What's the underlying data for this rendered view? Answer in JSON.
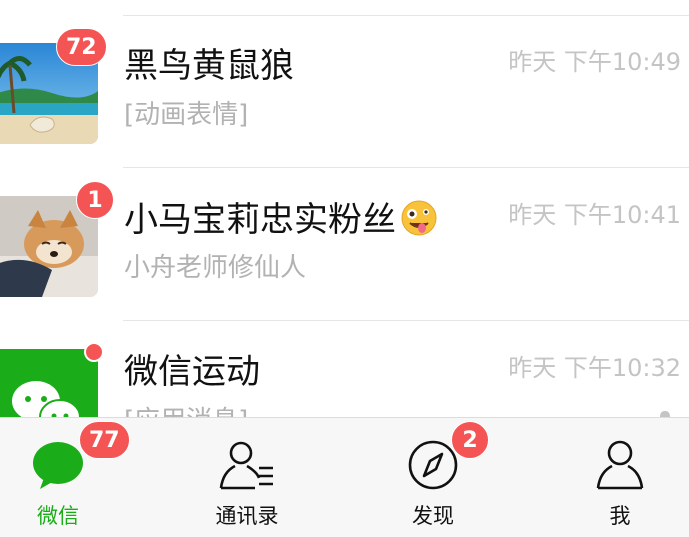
{
  "colors": {
    "accent": "#1aad19",
    "badge": "#f45454",
    "muted_text": "#b2b2b2",
    "tabbar_bg": "#f7f7f7"
  },
  "chats": [
    {
      "name": "黑鸟黄鼠狼",
      "preview": "[动画表情]",
      "time": "昨天 下午10:49",
      "badge": "72",
      "avatar": "beach-photo-avatar"
    },
    {
      "name": "小马宝莉忠实粉丝",
      "name_emoji": "zany-face-emoji",
      "preview": "小舟老师修仙人",
      "time": "昨天 下午10:41",
      "badge": "1",
      "avatar": "shiba-dog-photo-avatar"
    },
    {
      "name": "微信运动",
      "preview": "[应用消息]",
      "time": "昨天 下午10:32",
      "badge": null,
      "unread_dot": true,
      "avatar": "wechat-sports-avatar"
    }
  ],
  "tabbar": {
    "tabs": [
      {
        "label": "微信",
        "icon": "chat-bubble-icon",
        "badge": "77",
        "active": true
      },
      {
        "label": "通讯录",
        "icon": "contacts-icon",
        "badge": null,
        "active": false
      },
      {
        "label": "发现",
        "icon": "compass-icon",
        "badge": "2",
        "active": false
      },
      {
        "label": "我",
        "icon": "person-icon",
        "badge": null,
        "active": false
      }
    ]
  }
}
